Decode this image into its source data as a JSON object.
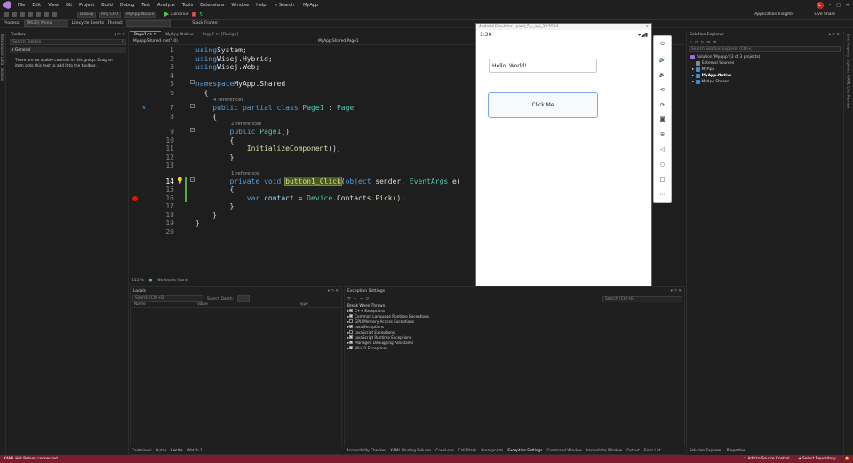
{
  "menu": {
    "items": [
      "File",
      "Edit",
      "View",
      "Git",
      "Project",
      "Build",
      "Debug",
      "Test",
      "Analyze",
      "Tools",
      "Extensions",
      "Window",
      "Help"
    ],
    "search_label": "Search",
    "app_title": "MyApp",
    "insights": "Application Insights",
    "live_share": "Live Share",
    "avatar": "L"
  },
  "toolbar": {
    "config": "Debug",
    "platform": "Any CPU",
    "project": "MyApp.Native",
    "continue": "Continue",
    "process_label": "Process:",
    "process": "[9636] Mono",
    "lifecycle": "Lifecycle Events",
    "thread": "Thread:",
    "stack": "Stack Frame:"
  },
  "toolbox": {
    "title": "Toolbox",
    "search": "Search Toolbox",
    "group": "General",
    "empty": "There are no usable controls in this group. Drag an item onto this text to add it to the toolbox."
  },
  "left_strip": [
    "Data Source Data",
    "Toolbox"
  ],
  "tabs": [
    "Page1.cs",
    "MyApp.Native",
    "Page1.cs [Design]"
  ],
  "navbar": {
    "project": "MyApp.Shared (net7.0)",
    "class": "MyApp.Shared.Page1",
    "member": "button1_Click(object sender, Ev"
  },
  "code": {
    "lines": [
      {
        "n": "1",
        "t": [
          [
            "kw",
            "using"
          ],
          [
            "",
            "System;"
          ]
        ]
      },
      {
        "n": "2",
        "t": [
          [
            "kw",
            "using"
          ],
          [
            "",
            "Wisej.Hybrid;"
          ]
        ]
      },
      {
        "n": "3",
        "t": [
          [
            "kw",
            "using"
          ],
          [
            "",
            "Wisej.Web;"
          ]
        ]
      },
      {
        "n": "4",
        "t": []
      },
      {
        "n": "5",
        "t": [
          [
            "kw",
            "namespace"
          ],
          [
            "",
            "MyApp.Shared"
          ]
        ]
      },
      {
        "n": "6",
        "t": [
          [
            "",
            "  {"
          ]
        ]
      },
      {
        "n": "7",
        "t": [
          [
            "kw",
            "    public partial class "
          ],
          [
            "ty",
            "Page1"
          ],
          [
            "",
            " : "
          ],
          [
            "ty",
            "Page"
          ]
        ]
      },
      {
        "n": "8",
        "t": [
          [
            "",
            "    {"
          ]
        ]
      },
      {
        "n": "9",
        "t": [
          [
            "kw",
            "        public "
          ],
          [
            "ty",
            "Page1"
          ],
          [
            "",
            "()"
          ]
        ]
      },
      {
        "n": "10",
        "t": [
          [
            "",
            "        {"
          ]
        ]
      },
      {
        "n": "11",
        "t": [
          [
            "fn",
            "            InitializeComponent"
          ],
          [
            "",
            "();"
          ]
        ]
      },
      {
        "n": "12",
        "t": [
          [
            "",
            "        }"
          ]
        ]
      },
      {
        "n": "13",
        "t": []
      },
      {
        "n": "14",
        "t": [
          [
            "kw",
            "        private void "
          ],
          [
            "fnh",
            "button1_Click"
          ],
          [
            "",
            "("
          ],
          [
            "kw",
            "object"
          ],
          [
            "",
            " sender, "
          ],
          [
            "ty",
            "EventArgs"
          ],
          [
            "",
            " e)"
          ]
        ]
      },
      {
        "n": "15",
        "t": [
          [
            "",
            "        {"
          ]
        ]
      },
      {
        "n": "16",
        "t": [
          [
            "kw",
            "            var "
          ],
          [
            "va",
            "contact"
          ],
          [
            "",
            " = "
          ],
          [
            "ty",
            "Device"
          ],
          [
            "",
            ".Contacts."
          ],
          [
            "fn",
            "Pick"
          ],
          [
            "",
            "();"
          ]
        ]
      },
      {
        "n": "17",
        "t": [
          [
            "",
            "        }"
          ]
        ]
      },
      {
        "n": "18",
        "t": [
          [
            "",
            "    }"
          ]
        ]
      },
      {
        "n": "19",
        "t": [
          [
            "",
            "}"
          ]
        ]
      },
      {
        "n": "20",
        "t": []
      }
    ],
    "codelens": {
      "refs4": "4 references",
      "refs2": "2 references",
      "refs1": "1 reference"
    }
  },
  "editor_status": {
    "zoom": "115 %",
    "issues": "No issues found"
  },
  "emulator": {
    "title": "Android Emulator - pixel_5_-_api_33:5554",
    "time": "3:29",
    "text_value": "Hello, World!",
    "button_label": "Click Me"
  },
  "solution": {
    "title": "Solution Explorer",
    "search": "Search Solution Explorer (Ctrl+;)",
    "solution": "Solution 'MyApp' (3 of 3 projects)",
    "items": [
      "External Sources",
      "MyApp",
      "MyApp.Native",
      "MyApp.Shared"
    ]
  },
  "right_strip": [
    "Live Property Explorer",
    "XAML Live Preview"
  ],
  "locals": {
    "title": "Locals",
    "search": "Search (Ctrl+E)",
    "depth": "Search Depth:",
    "cols": [
      "Name",
      "Value",
      "Type"
    ]
  },
  "exceptions": {
    "title": "Exception Settings",
    "search": "Search (Ctrl+E)",
    "header": "Break When Thrown",
    "items": [
      "C++ Exceptions",
      "Common Language Runtime Exceptions",
      "GPU Memory Access Exceptions",
      "Java Exceptions",
      "JavaScript Exceptions",
      "JavaScript Runtime Exceptions",
      "Managed Debugging Assistants",
      "Win32 Exceptions"
    ],
    "checked": [
      true,
      true,
      false,
      true,
      false,
      true,
      true,
      true
    ]
  },
  "bottom_tabs_left": [
    "Containers",
    "Autos",
    "Locals",
    "Watch 1"
  ],
  "bottom_tabs_right": [
    "Accessibility Checker",
    "XAML Binding Failures",
    "CodeLens",
    "Call Stack",
    "Breakpoints",
    "Exception Settings",
    "Command Window",
    "Immediate Window",
    "Output",
    "Error List"
  ],
  "sol_bottom_tabs": [
    "Solution Explorer",
    "Properties"
  ],
  "statusbar": {
    "left": "XAML Hot Reload connected",
    "source": "Add to Source Control",
    "repo": "Select Repository"
  }
}
